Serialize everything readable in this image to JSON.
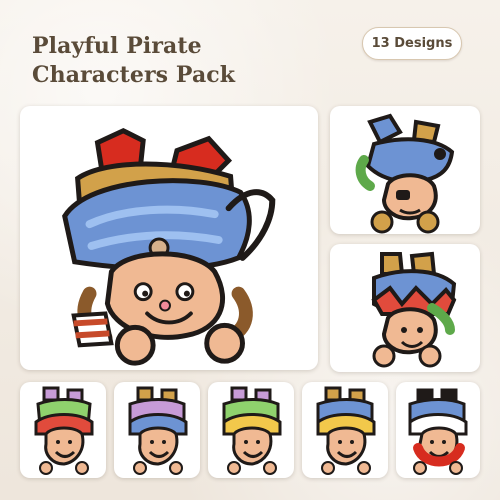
{
  "header": {
    "title_line1": "Playful Pirate",
    "title_line2": "Characters Pack",
    "badge": "13 Designs"
  },
  "designs": [
    {
      "name": "pirate-large-blue-bandana",
      "size": "large"
    },
    {
      "name": "pirate-blue-bandana-eyepatch",
      "size": "medium"
    },
    {
      "name": "pirate-jester-hat",
      "size": "medium"
    },
    {
      "name": "pirate-red-bandana-beard",
      "size": "small"
    },
    {
      "name": "pirate-purple-hat",
      "size": "small"
    },
    {
      "name": "pirate-yellow-bandana",
      "size": "small"
    },
    {
      "name": "pirate-curly-blond-hair",
      "size": "small"
    },
    {
      "name": "pirate-captain-red-beard",
      "size": "small"
    }
  ],
  "colors": {
    "background": "#f1ebe3",
    "title": "#5a4b39",
    "badge_border": "#d8c7b0"
  }
}
